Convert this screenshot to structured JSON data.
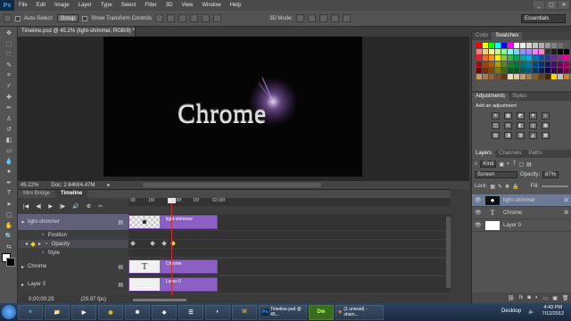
{
  "menubar": {
    "logo": "Ps",
    "items": [
      "File",
      "Edit",
      "Image",
      "Layer",
      "Type",
      "Select",
      "Filter",
      "3D",
      "View",
      "Window",
      "Help"
    ],
    "window_controls": [
      "_",
      "▢",
      "✕"
    ]
  },
  "options_bar": {
    "auto_select_label": "Auto-Select:",
    "auto_select_value": "Group",
    "show_transform_label": "Show Transform Controls",
    "mode_3d_label": "3D Mode:",
    "workspace": "Essentials"
  },
  "document": {
    "tab_title": "Timeline.psd @ 45.2% (light-shimmer, RGB/8) *",
    "canvas_text": "Chrome",
    "zoom": "45.22%",
    "doc_size": "Doc: 2.64M/4.47M"
  },
  "timeline": {
    "tabs": [
      "Mini Bridge",
      "Timeline"
    ],
    "ruler_labels": [
      "00",
      "15f",
      "01:00f",
      "15f",
      "02:00f"
    ],
    "current_time": "0;00;00;29",
    "fps": "(29.97 fps)",
    "layers": [
      {
        "name": "light-shimmer",
        "clip": "light-shimmer",
        "thumb": "●"
      },
      {
        "name": "Chrome",
        "clip": "Chrome",
        "thumb": "T"
      },
      {
        "name": "Layer 0",
        "clip": "Layer 0",
        "thumb": ""
      }
    ],
    "properties": [
      "Position",
      "Opacity",
      "Style"
    ]
  },
  "swatches_panel": {
    "tabs": [
      "Color",
      "Swatches"
    ],
    "colors": [
      "#ff0000",
      "#ffff00",
      "#00ff00",
      "#00ffff",
      "#0000ff",
      "#ff00ff",
      "#ffffff",
      "#ebebeb",
      "#d6d6d6",
      "#c2c2c2",
      "#adadad",
      "#999999",
      "#858585",
      "#707070",
      "#5c5c5c",
      "#474747",
      "#ff8080",
      "#ffc880",
      "#fff280",
      "#c8ff80",
      "#80ff9c",
      "#80ffe6",
      "#80d2ff",
      "#8c96ff",
      "#b080ff",
      "#f080ff",
      "#ff80c4",
      "#333333",
      "#1f1f1f",
      "#0a0a0a",
      "#000000",
      "#ed1c24",
      "#ed1c24",
      "#f26522",
      "#f7941d",
      "#fff200",
      "#8dc63f",
      "#39b54a",
      "#00a651",
      "#00a99d",
      "#00aeef",
      "#0072bc",
      "#0054a6",
      "#2e3192",
      "#662d91",
      "#92278f",
      "#ec008c",
      "#ed145b",
      "#9e0b0f",
      "#a0410d",
      "#a3620a",
      "#aba000",
      "#598527",
      "#1a7b30",
      "#007236",
      "#00746b",
      "#0076a3",
      "#004a80",
      "#003471",
      "#1b1464",
      "#440e62",
      "#630460",
      "#9e005d",
      "#9e0039",
      "#790000",
      "#7b2e00",
      "#7d4900",
      "#827b00",
      "#406618",
      "#005e20",
      "#005826",
      "#005952",
      "#005b7f",
      "#003663",
      "#002157",
      "#0d004c",
      "#32004b",
      "#4b0049",
      "#7b0046",
      "#7a0026",
      "#c69c6d",
      "#a67c52",
      "#8c6239",
      "#754c24",
      "#603913",
      "#f0e0c0",
      "#e0c8a0",
      "#c0a070",
      "#a08050",
      "#806030",
      "#604018",
      "#402808",
      "#ffd700",
      "#c0c0c0",
      "#cd7f32",
      "#b87333"
    ]
  },
  "adjustments_panel": {
    "tabs": [
      "Adjustments",
      "Styles"
    ],
    "title": "Add an adjustment",
    "icons": [
      "☀",
      "▦",
      "◩",
      "▼",
      "◐",
      "◫",
      "⚖",
      "◧",
      "◎",
      "▣",
      "▤",
      "◨",
      "▥",
      "◭",
      "▩"
    ]
  },
  "layers_panel": {
    "tabs": [
      "Layers",
      "Channels",
      "Paths"
    ],
    "kind_label": "Kind",
    "blend_mode": "Screen",
    "opacity_label": "Opacity:",
    "opacity_value": "87%",
    "lock_label": "Lock:",
    "fill_label": "Fill:",
    "layers": [
      {
        "name": "light-shimmer",
        "thumb": "●",
        "fx": "fx"
      },
      {
        "name": "Chrome",
        "thumb": "T",
        "fx": "fx"
      },
      {
        "name": "Layer 0",
        "thumb": "",
        "fx": ""
      }
    ]
  },
  "taskbar": {
    "tasks": [
      "e",
      "📁",
      "▶",
      "◉",
      "✱",
      "◆",
      "☰",
      "◐",
      "W"
    ],
    "ps_task": "Timeline.psd @ 45...",
    "dw_task": "Dw",
    "ff_task": "(1 unread) - sham...",
    "tray_label": "Desktop",
    "time": "4:43 PM",
    "date": "7/12/2012"
  }
}
